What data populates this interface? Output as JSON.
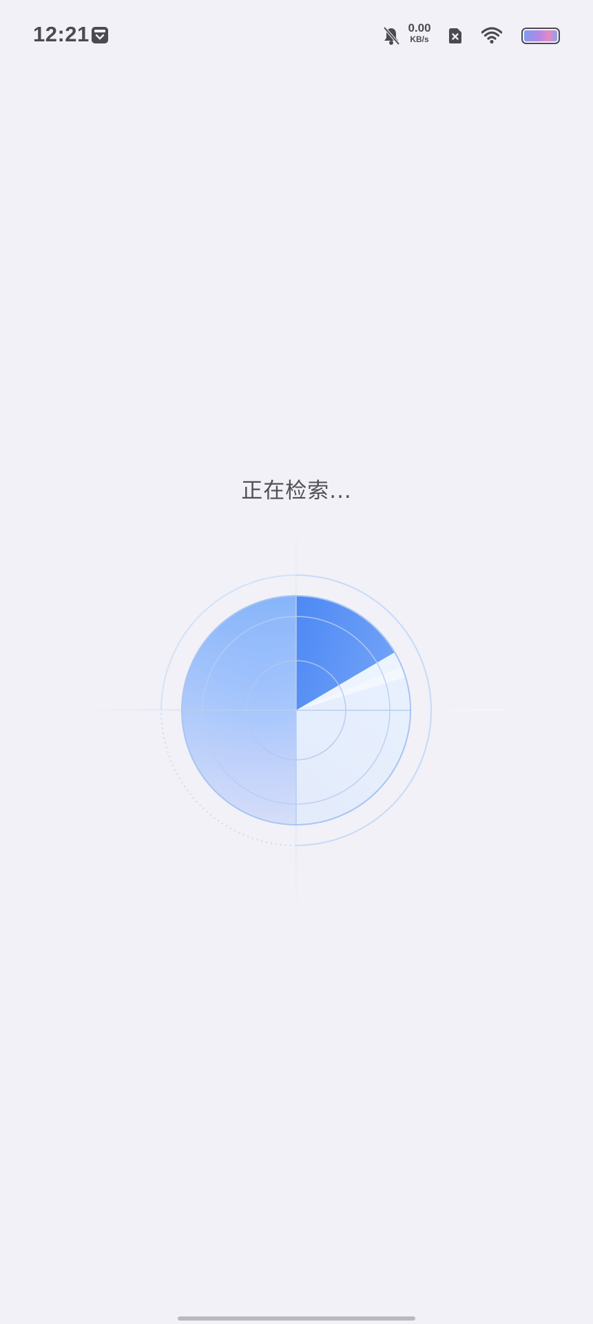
{
  "status_bar": {
    "time": "12:21",
    "net_speed_value": "0.00",
    "net_speed_unit": "KB/s",
    "icons": [
      "screen-cast-icon",
      "bell-muted-icon",
      "sim-disabled-icon",
      "wifi-icon",
      "battery-icon"
    ]
  },
  "main": {
    "status_text": "正在检索..."
  },
  "colors": {
    "background": "#f1f1f7",
    "radar_blue": "#4d89f5",
    "radar_light": "#bdd6ff",
    "text": "#4f4f55"
  }
}
